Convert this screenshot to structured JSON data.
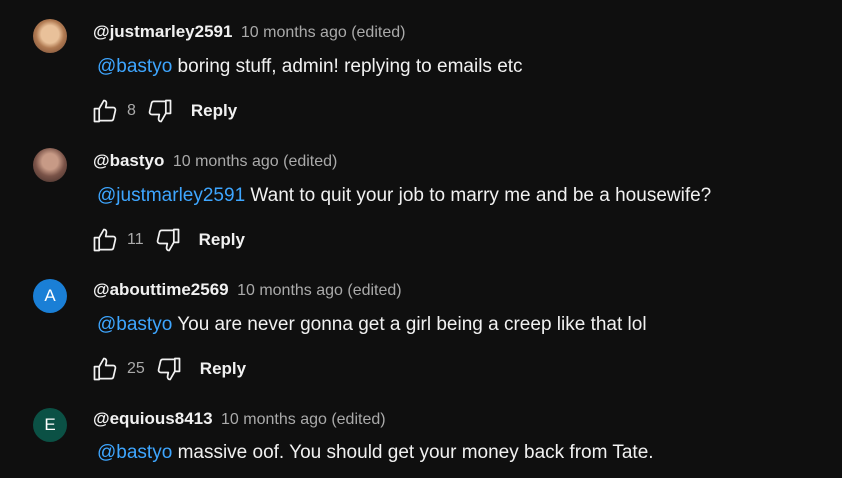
{
  "colors": {
    "background": "#0f0f0f",
    "mention": "#3ea6ff",
    "meta": "#aaaaaa",
    "avatar_a": "#1a7fd6",
    "avatar_e": "#0b5145"
  },
  "comments": [
    {
      "author": "@justmarley2591",
      "meta": "10 months ago (edited)",
      "mention": "@bastyo",
      "text": " boring stuff, admin! replying to emails etc",
      "likes": "8",
      "reply_label": "Reply",
      "avatar_letter": ""
    },
    {
      "author": "@bastyo",
      "meta": "10 months ago (edited)",
      "mention": "@justmarley2591",
      "text": " Want to quit your job to marry me and be a housewife?",
      "likes": "11",
      "reply_label": "Reply",
      "avatar_letter": ""
    },
    {
      "author": "@abouttime2569",
      "meta": "10 months ago (edited)",
      "mention": "@bastyo",
      "text": " You are never gonna get a girl being a creep like that lol",
      "likes": "25",
      "reply_label": "Reply",
      "avatar_letter": "A"
    },
    {
      "author": "@equious8413",
      "meta": "10 months ago (edited)",
      "mention": "@bastyo",
      "text": "massive oof. You should get your money back from Tate.",
      "avatar_letter": "E"
    }
  ]
}
